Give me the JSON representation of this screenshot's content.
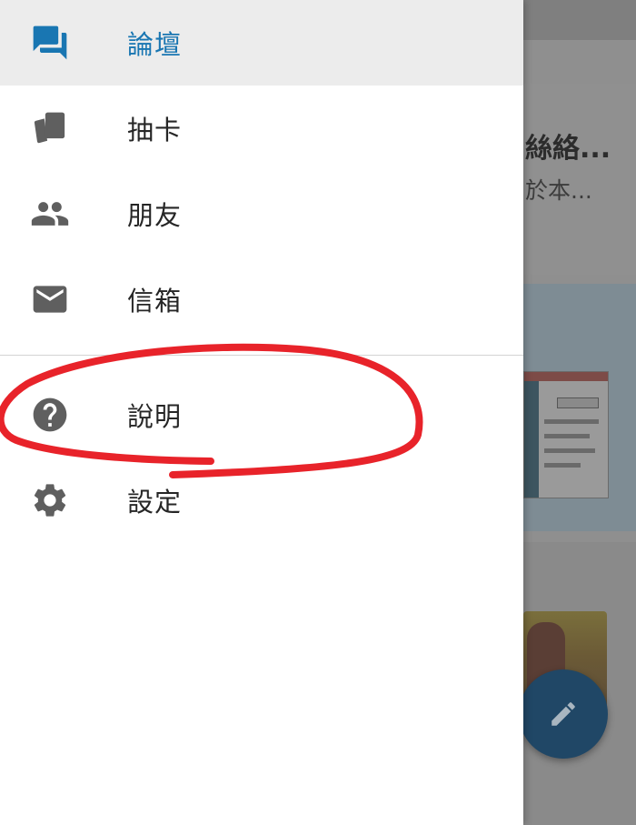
{
  "background": {
    "card_title": "絲絡...",
    "card_subtitle": "於本..."
  },
  "drawer": {
    "items": [
      {
        "label": "論壇",
        "icon": "forum-icon",
        "active": true
      },
      {
        "label": "抽卡",
        "icon": "cards-icon",
        "active": false
      },
      {
        "label": "朋友",
        "icon": "people-icon",
        "active": false
      },
      {
        "label": "信箱",
        "icon": "mail-icon",
        "active": false
      },
      {
        "label": "說明",
        "icon": "help-icon",
        "active": false
      },
      {
        "label": "設定",
        "icon": "settings-icon",
        "active": false
      }
    ]
  },
  "fab": {
    "icon": "pencil-icon"
  },
  "colors": {
    "accent": "#1976b2",
    "icon_gray": "#616161",
    "active_bg": "#ececec",
    "fab_blue": "#204766",
    "annotation_red": "#e8232a"
  }
}
